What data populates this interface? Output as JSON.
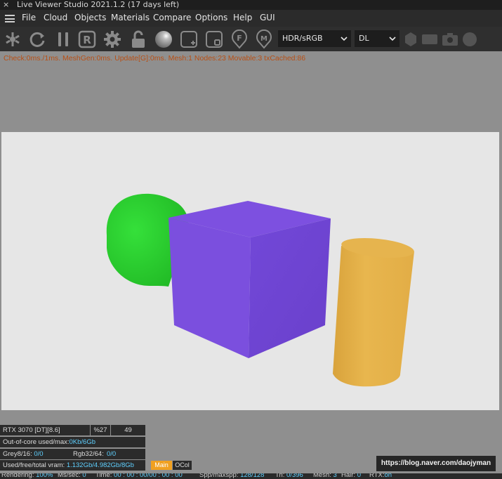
{
  "window": {
    "title": "Live Viewer Studio 2021.1.2 (17 days left)",
    "close_glyph": "×"
  },
  "menu": [
    "File",
    "Cloud",
    "Objects",
    "Materials",
    "Compare",
    "Options",
    "Help",
    "GUI"
  ],
  "toolbar": {
    "icons": [
      "octane-logo-icon",
      "refresh-icon",
      "pause-icon",
      "restart-r-icon",
      "settings-gear-icon",
      "unlock-icon",
      "material-sphere-icon",
      "add-region-icon",
      "region-icon",
      "focus-pin-icon",
      "material-pin-icon"
    ],
    "restart_letter": "R",
    "focus_letter": "F",
    "material_letter": "M",
    "colorspace": "HDR/sRGB",
    "kernel": "DL",
    "trailing_icons": [
      "hexagon-icon",
      "film-icon",
      "camera-icon",
      "circle-icon"
    ]
  },
  "stats_line": "Check:0ms./1ms. MeshGen:0ms. Update[G]:0ms. Mesh:1 Nodes:23 Movable:3 txCached:86",
  "scene": {
    "objects": [
      "green-sphere",
      "purple-cube",
      "yellow-cylinder"
    ],
    "colors": {
      "background": "#e6e6e6",
      "sphere": "#2ed12e",
      "cube_front": "#7b4fde",
      "cube_top": "#7d50e0",
      "cube_side": "#6f43d0",
      "cylinder": "#e5b24a"
    }
  },
  "info": {
    "gpu": "RTX 3070 [DT][8.6]",
    "gpu_load": "%27",
    "gpu_temp": "49",
    "ooc_label": "Out-of-core used/max:",
    "ooc_value": "0Kb/6Gb",
    "grey_label": "Grey8/16:",
    "grey_value": "0/0",
    "rgb_label": "Rgb32/64:",
    "rgb_value": "0/0",
    "vram_label": "Used/free/total vram:",
    "vram_value": "1.132Gb/4.982Gb/8Gb",
    "tab_main": "Main",
    "tab_ocol": "OCol",
    "url": "https://blog.naver.com/daojyman"
  },
  "status": {
    "rendering_label": "Rendering:",
    "rendering_value": "100%",
    "mspersec_label": "Ms/sec:",
    "mspersec_value": "0",
    "time_label": "Time:",
    "time_value": "00 : 00 : 00/00 : 00 : 00",
    "spp_label": "Spp/maxspp:",
    "spp_value": "128/128",
    "tri_label": "Tri:",
    "tri_value": "0/396",
    "mesh_label": "Mesh:",
    "mesh_value": "3",
    "hair_label": "Hair:",
    "hair_value": "0",
    "rtx_label": "RTX:",
    "rtx_value": "on"
  }
}
